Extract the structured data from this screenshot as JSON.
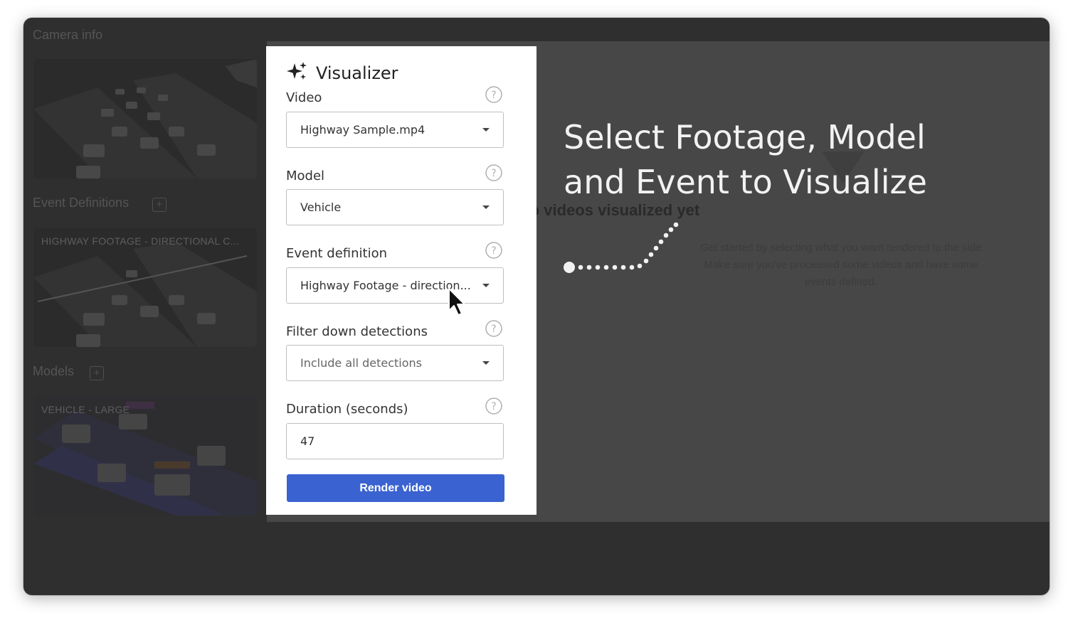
{
  "sidebar": {
    "camera_info_title": "Camera info",
    "event_definitions_title": "Event Definitions",
    "models_title": "Models",
    "add_symbol": "+",
    "event_thumb_label": "HIGHWAY FOOTAGE - DIRECTIONAL C...",
    "model_thumb_label": "VEHICLE - LARGE"
  },
  "main": {
    "empty_title": "No videos visualized yet",
    "empty_description": "Get started by selecting what you want rendered to the side Make sure you've processed some videos and have some events defined."
  },
  "overlay": {
    "heading": "Select Footage, Model and Event to Visualize"
  },
  "visualizer": {
    "title": "Visualizer",
    "fields": {
      "video": {
        "label": "Video",
        "value": "Highway Sample.mp4"
      },
      "model": {
        "label": "Model",
        "value": "Vehicle"
      },
      "event": {
        "label": "Event definition",
        "value": "Highway Footage - direction..."
      },
      "filter": {
        "label": "Filter down detections",
        "placeholder": "Include all detections"
      },
      "duration": {
        "label": "Duration (seconds)",
        "value": "47"
      }
    },
    "render_button": "Render video"
  },
  "colors": {
    "accent": "#3a62d0",
    "dim_overlay": "#474747",
    "window_bg": "#2f2f2f"
  },
  "icons": [
    "sparkle-icon",
    "help-icon",
    "caret-down-icon",
    "plus-icon",
    "mouse-cursor-icon"
  ]
}
